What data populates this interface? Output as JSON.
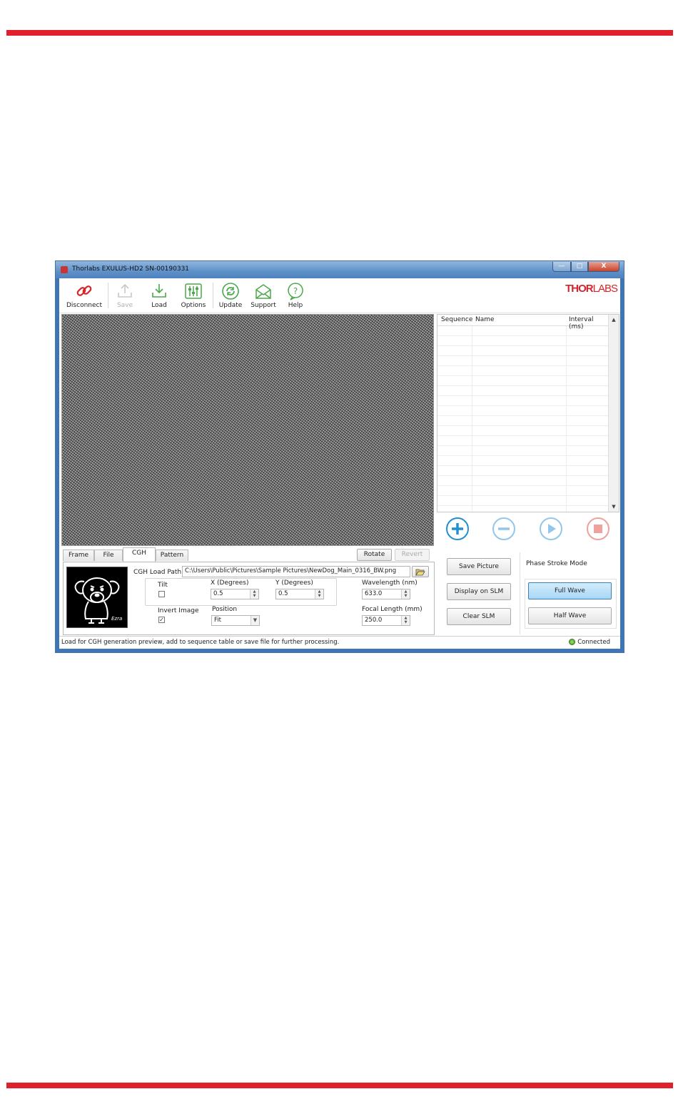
{
  "window": {
    "title": "Thorlabs EXULUS-HD2 SN-00190331",
    "controls": [
      "—",
      "□",
      "X"
    ]
  },
  "toolbar": {
    "items": [
      {
        "label": "Disconnect",
        "icon": "link-icon",
        "enabled": true
      },
      {
        "label": "Save",
        "icon": "save-icon",
        "enabled": false
      },
      {
        "label": "Load",
        "icon": "load-icon",
        "enabled": true
      },
      {
        "label": "Options",
        "icon": "sliders-icon",
        "enabled": true
      },
      {
        "label": "Update",
        "icon": "refresh-icon",
        "enabled": true
      },
      {
        "label": "Support",
        "icon": "envelope-icon",
        "enabled": true
      },
      {
        "label": "Help",
        "icon": "help-icon",
        "enabled": true
      }
    ],
    "logo": {
      "part1": "THOR",
      "part2": "LABS"
    }
  },
  "sequence_table": {
    "columns": [
      "Sequence",
      "Name",
      "Interval (ms)"
    ],
    "rows": []
  },
  "sequence_controls": [
    "add-icon",
    "remove-icon",
    "play-icon",
    "stop-icon"
  ],
  "tabs": [
    {
      "label": "Frame",
      "active": false
    },
    {
      "label": "File",
      "active": false
    },
    {
      "label": "CGH",
      "active": true
    },
    {
      "label": "Pattern",
      "active": false
    }
  ],
  "image_buttons": {
    "rotate": "Rotate",
    "revert": "Revert"
  },
  "cgh": {
    "load_path_label": "CGH Load Path",
    "load_path": "C:\\Users\\Public\\Pictures\\Sample Pictures\\NewDog_Main_0316_BW.png",
    "thumbnail_caption": "Ezra",
    "tilt_label": "Tilt",
    "tilt_checked": false,
    "x_label": "X (Degrees)",
    "x_value": "0.5",
    "y_label": "Y (Degrees)",
    "y_value": "0.5",
    "wavelength_label": "Wavelength (nm)",
    "wavelength_value": "633.0",
    "invert_label": "Invert Image",
    "invert_checked": "✓",
    "position_label": "Position",
    "position_value": "Fit",
    "focal_label": "Focal Length (mm)",
    "focal_value": "250.0"
  },
  "actions": {
    "save_picture": "Save Picture",
    "display_on_slm": "Display on SLM",
    "clear_slm": "Clear SLM"
  },
  "phase_stroke": {
    "label": "Phase Stroke Mode",
    "full_wave": "Full Wave",
    "half_wave": "Half Wave",
    "selected": "Full Wave"
  },
  "status": {
    "message": "Load for CGH generation preview, add to sequence table or save file for further processing.",
    "connection": "Connected"
  },
  "colors": {
    "brand_red": "#e0202a",
    "accent_blue": "#1f8fd6",
    "stop_red": "#e0504a",
    "connected_green": "#3d9a1f"
  }
}
